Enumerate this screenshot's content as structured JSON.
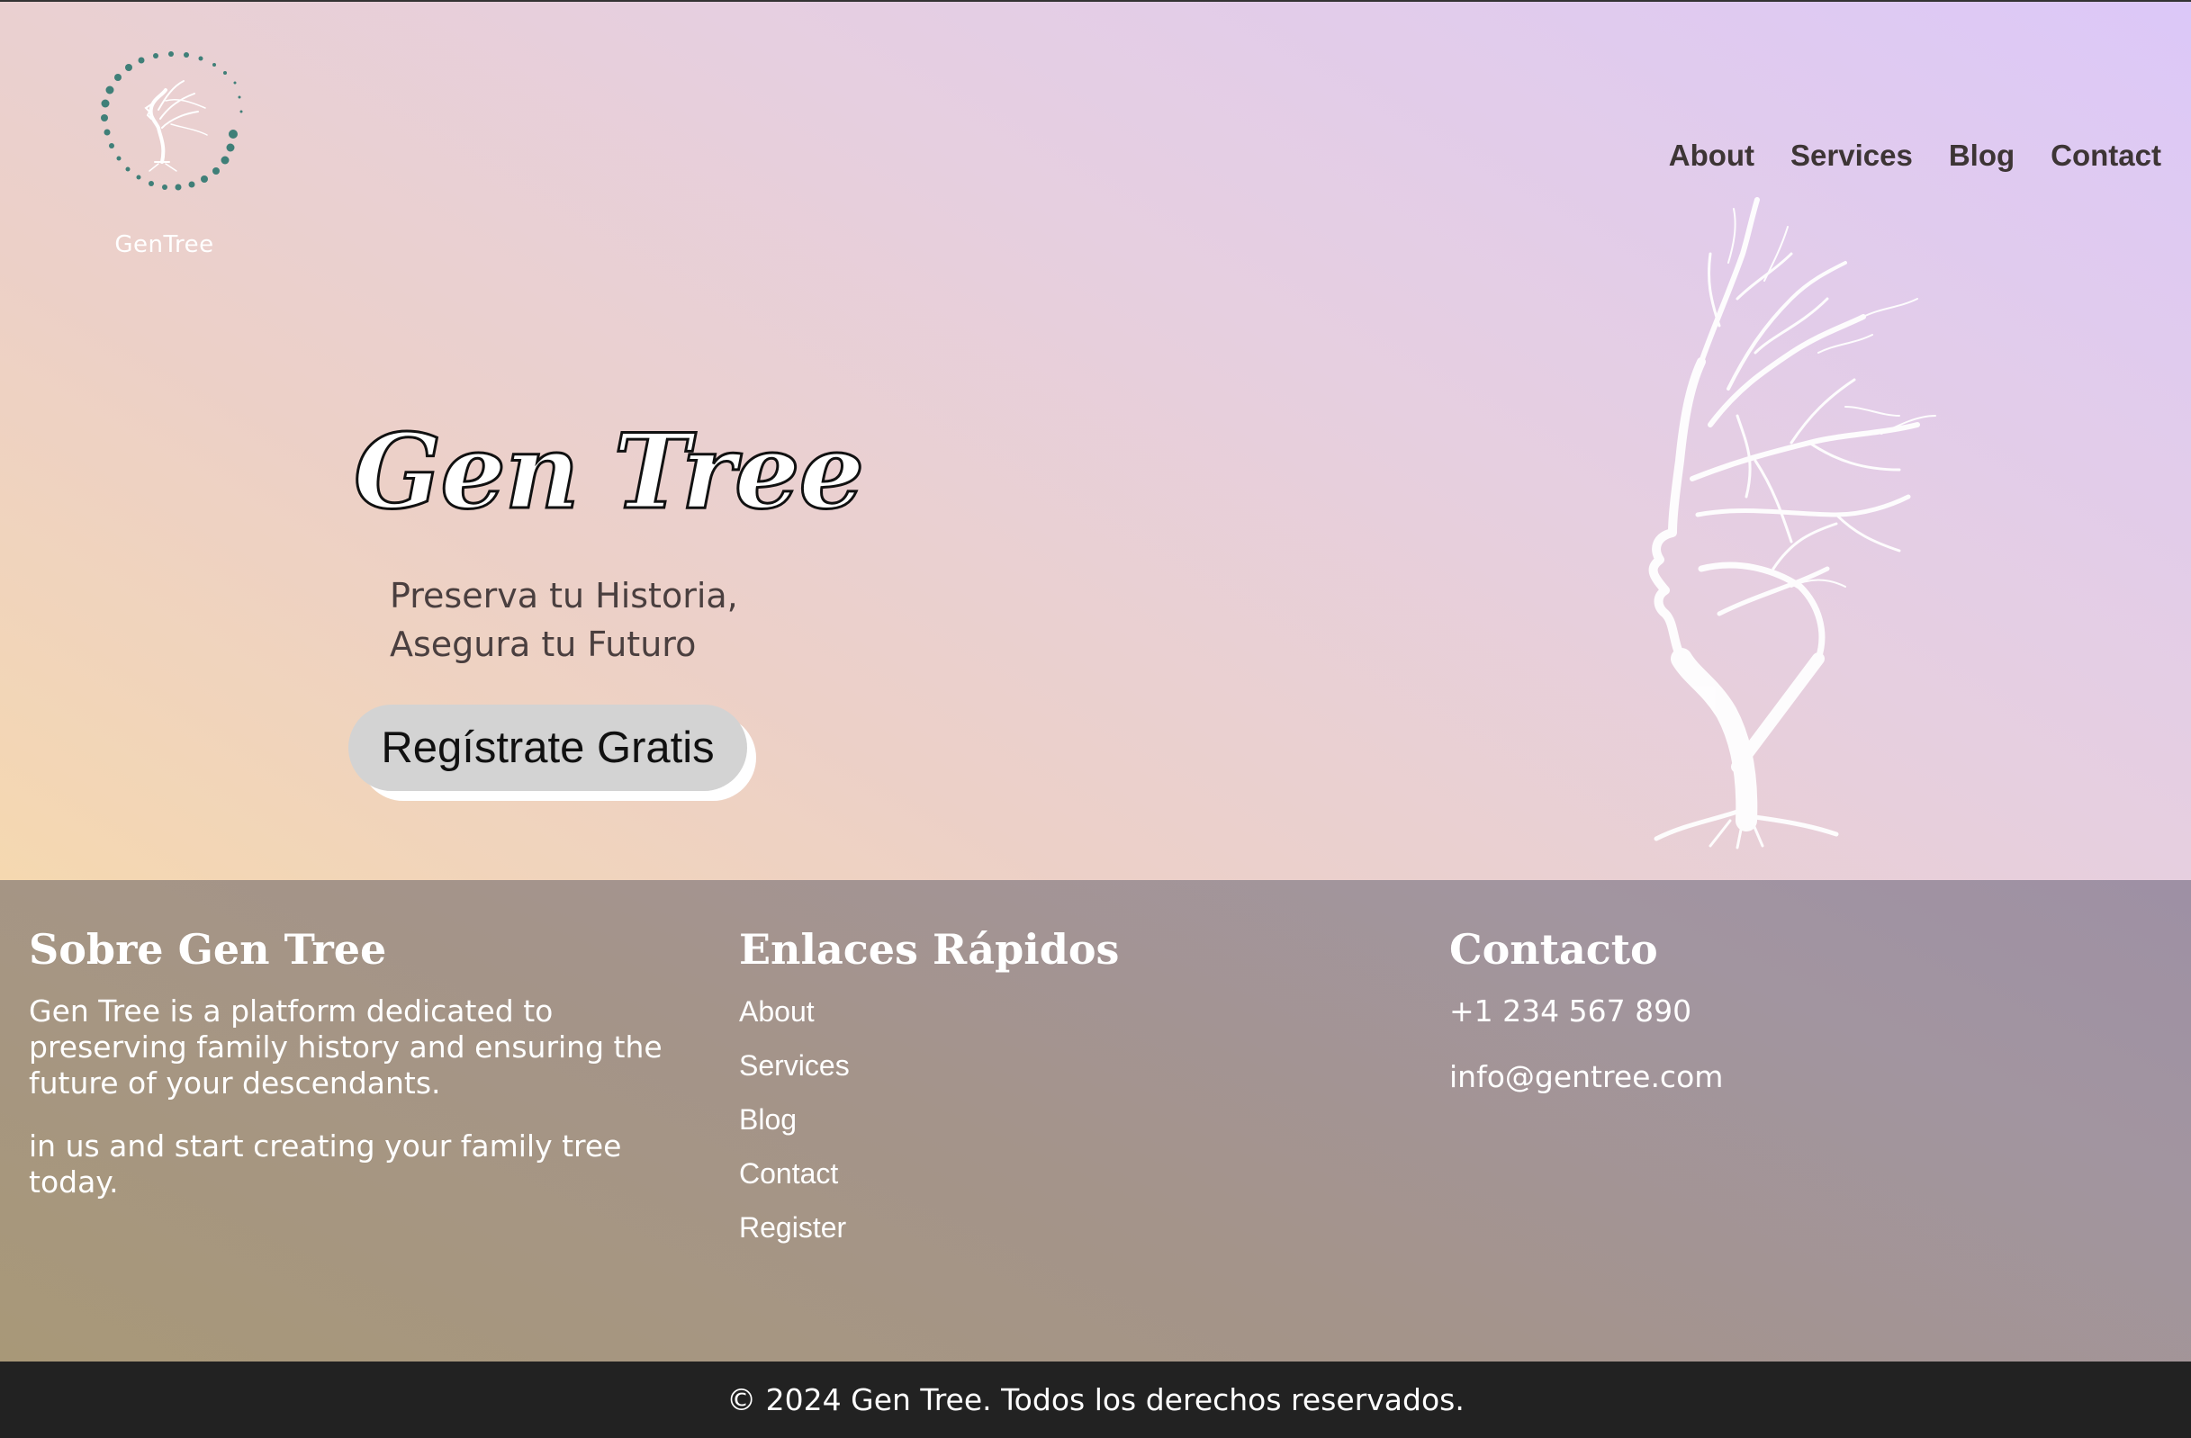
{
  "logo": {
    "text": "GenTree"
  },
  "nav": {
    "items": [
      "About",
      "Services",
      "Blog",
      "Contact"
    ]
  },
  "hero": {
    "title": "Gen Tree",
    "subtitle_line1": "Preserva tu Historia,",
    "subtitle_line2": "Asegura tu Futuro",
    "cta_label": "Regístrate Gratis"
  },
  "footer": {
    "about": {
      "heading": "Sobre Gen Tree",
      "text1": "Gen Tree is a platform dedicated to preserving family history and ensuring the future of your descendants.",
      "text2": "in us and start creating your family tree today."
    },
    "links": {
      "heading": "Enlaces Rápidos",
      "items": [
        "About",
        "Services",
        "Blog",
        "Contact",
        "Register"
      ]
    },
    "contact": {
      "heading": "Contacto",
      "phone": "+1 234 567 890",
      "email": "info@gentree.com"
    },
    "copyright": "© 2024 Gen Tree. Todos los derechos reservados."
  },
  "colors": {
    "logo_dots": "#3f7f78",
    "nav_text": "#3d3535",
    "footer_bottom": "#222222"
  }
}
